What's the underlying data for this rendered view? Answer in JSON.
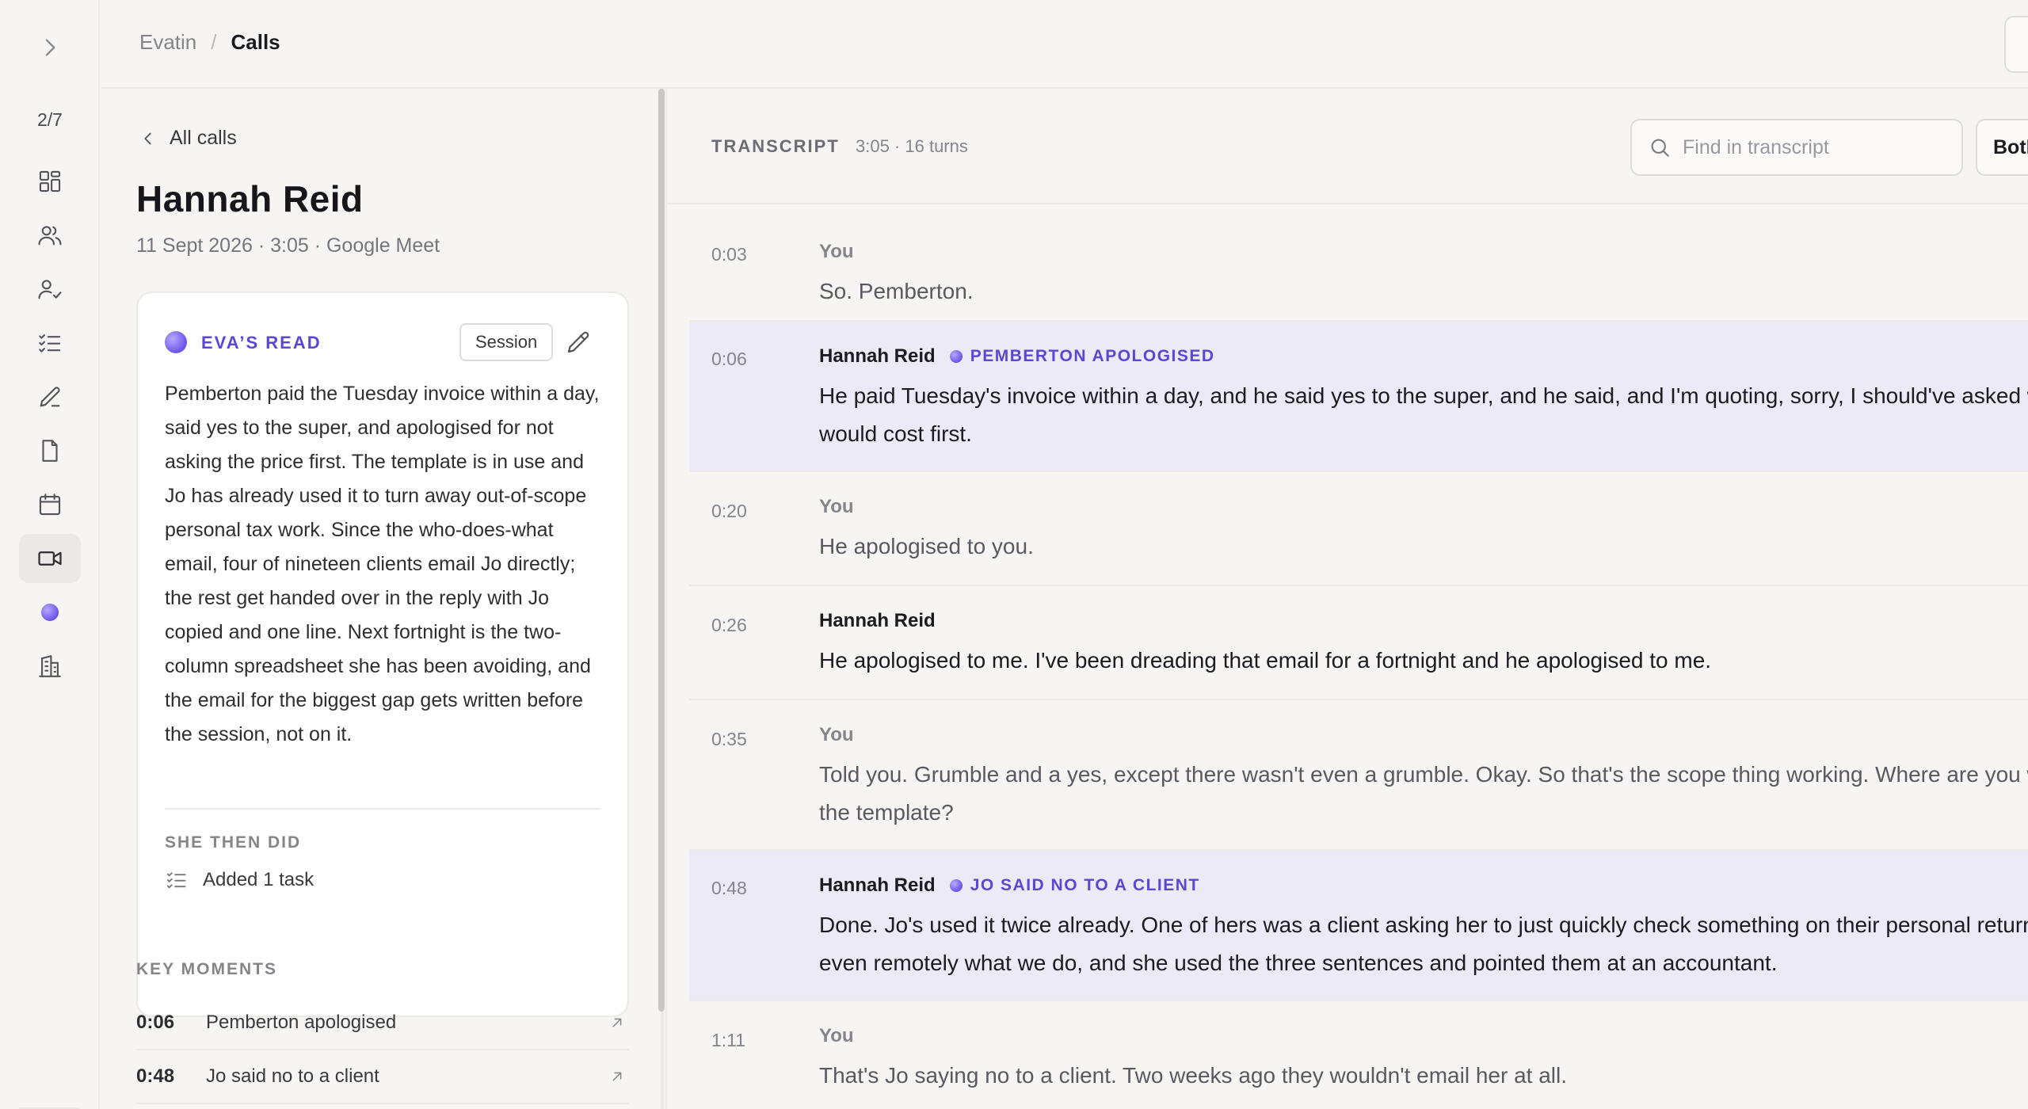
{
  "rail": {
    "counter": "2/7",
    "items": [
      {
        "name": "dashboard-icon"
      },
      {
        "name": "people-icon"
      },
      {
        "name": "person-check-icon"
      },
      {
        "name": "checklist-icon"
      },
      {
        "name": "pencil-icon"
      },
      {
        "name": "document-icon"
      },
      {
        "name": "calendar-icon"
      },
      {
        "name": "video-icon",
        "active": true
      },
      {
        "name": "eva-orb-icon"
      },
      {
        "name": "building-icon"
      }
    ]
  },
  "header": {
    "breadcrumb_root": "Evatin",
    "breadcrumb_sep": "/",
    "breadcrumb_current": "Calls"
  },
  "detail": {
    "back_label": "All calls",
    "name": "Hannah Reid",
    "meta": "11 Sept 2026 · 3:05 · Google Meet",
    "read": {
      "title": "EVA’S READ",
      "tag": "Session",
      "body": "Pemberton paid the Tuesday invoice within a day, said yes to the super, and apologised for not asking the price first. The template is in use and Jo has already used it to turn away out-of-scope personal tax work. Since the who-does-what email, four of nineteen clients email Jo directly; the rest get handed over in the reply with Jo copied and one line. Next fortnight is the two-column spreadsheet she has been avoiding, and the email for the biggest gap gets written before the session, not on it.",
      "then_label": "SHE THEN DID",
      "then_item": "Added 1 task"
    },
    "moments_label": "KEY MOMENTS",
    "moments": [
      {
        "time": "0:06",
        "label": "Pemberton apologised"
      },
      {
        "time": "0:48",
        "label": "Jo said no to a client"
      }
    ]
  },
  "transcript": {
    "title": "TRANSCRIPT",
    "meta": "3:05 · 16 turns",
    "search_placeholder": "Find in transcript",
    "filter_label": "Both",
    "turns": [
      {
        "time": "0:03",
        "speaker": "You",
        "text": [
          "So. Pemberton."
        ]
      },
      {
        "time": "0:06",
        "speaker": "Hannah Reid",
        "tag": "PEMBERTON APOLOGISED",
        "text": [
          "He paid Tuesday's invoice within a day, and he said yes to the super, and he said, and I'm quoting, sorry, I should've asked what it",
          "would cost first."
        ]
      },
      {
        "time": "0:20",
        "speaker": "You",
        "text": [
          "He apologised to you."
        ]
      },
      {
        "time": "0:26",
        "speaker": "Hannah Reid",
        "text": [
          "He apologised to me. I've been dreading that email for a fortnight and he apologised to me."
        ]
      },
      {
        "time": "0:35",
        "speaker": "You",
        "text": [
          "Told you. Grumble and a yes, except there wasn't even a grumble. Okay. So that's the scope thing working. Where are you with",
          "the template?"
        ]
      },
      {
        "time": "0:48",
        "speaker": "Hannah Reid",
        "tag": "JO SAID NO TO A CLIENT",
        "text": [
          "Done. Jo's used it twice already. One of hers was a client asking her to just quickly check something on their personal return, not",
          "even remotely what we do, and she used the three sentences and pointed them at an accountant."
        ]
      },
      {
        "time": "1:11",
        "speaker": "You",
        "text": [
          "That's Jo saying no to a client. Two weeks ago they wouldn't email her at all."
        ]
      }
    ]
  }
}
